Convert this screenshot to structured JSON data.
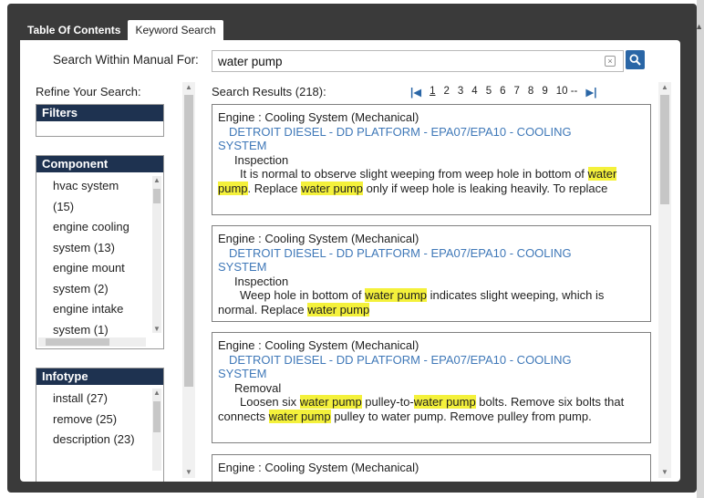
{
  "tabs": [
    {
      "label": "Table Of Contents",
      "active": false
    },
    {
      "label": "Keyword Search",
      "active": true
    }
  ],
  "search": {
    "label": "Search Within Manual For:",
    "value": "water pump"
  },
  "refine": {
    "title": "Refine Your Search:",
    "filters": {
      "title": "Filters"
    },
    "component": {
      "title": "Component",
      "items": [
        "hvac system (15)",
        "engine cooling system (13)",
        "engine mount system (2)",
        "engine intake system (1)"
      ]
    },
    "infotype": {
      "title": "Infotype",
      "items": [
        "install (27)",
        "remove (25)",
        "description (23)"
      ]
    }
  },
  "results": {
    "title": "Search Results (218):",
    "pager": {
      "pages": [
        "1",
        "2",
        "3",
        "4",
        "5",
        "6",
        "7",
        "8",
        "9",
        "10 --"
      ],
      "current": "1"
    },
    "items": [
      {
        "path": "Engine : Cooling System (Mechanical)",
        "link1": "DETROIT DIESEL - DD PLATFORM - EPA07/EPA10 - COOLING",
        "link2": "SYSTEM",
        "type": "Inspection",
        "snippet": [
          {
            "t": "It is normal to observe slight weeping from weep hole in bottom of "
          },
          {
            "t": "water pump",
            "h": true
          },
          {
            "t": ". Replace "
          },
          {
            "t": "water pump",
            "h": true
          },
          {
            "t": " only if weep hole is leaking heavily. To replace"
          }
        ]
      },
      {
        "path": "Engine : Cooling System (Mechanical)",
        "link1": "DETROIT DIESEL - DD PLATFORM - EPA07/EPA10 - COOLING",
        "link2": "SYSTEM",
        "type": "Inspection",
        "snippet": [
          {
            "t": "Weep hole in bottom of "
          },
          {
            "t": "water pump",
            "h": true
          },
          {
            "t": " indicates slight weeping, which is normal. Replace "
          },
          {
            "t": "water pump",
            "h": true
          }
        ]
      },
      {
        "path": "Engine : Cooling System (Mechanical)",
        "link1": "DETROIT DIESEL - DD PLATFORM - EPA07/EPA10 - COOLING",
        "link2": "SYSTEM",
        "type": "Removal",
        "snippet": [
          {
            "t": "Loosen six "
          },
          {
            "t": "water pump",
            "h": true
          },
          {
            "t": " pulley-to-"
          },
          {
            "t": "water pump",
            "h": true
          },
          {
            "t": " bolts.      Remove six bolts that connects "
          },
          {
            "t": "water pump",
            "h": true
          },
          {
            "t": " pulley to water pump. Remove pulley from pump."
          }
        ]
      },
      {
        "path": "Engine : Cooling System (Mechanical)"
      }
    ]
  }
}
